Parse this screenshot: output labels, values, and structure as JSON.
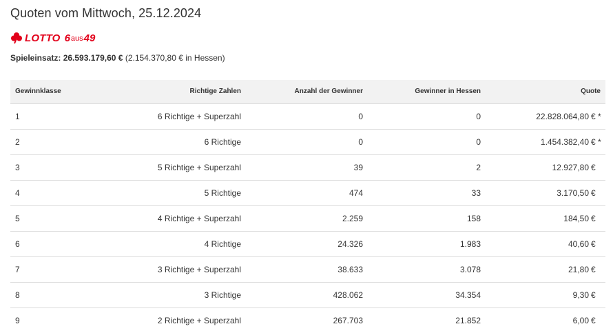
{
  "page": {
    "title": "Quoten vom Mittwoch, 25.12.2024"
  },
  "logo": {
    "word": "LOTTO",
    "six": "6",
    "aus": "aus",
    "fortynine": "49",
    "color": "#e2001a"
  },
  "stake": {
    "label": "Spieleinsatz:",
    "amount": "26.593.179,60",
    "currency": "€",
    "hessen": "(2.154.370,80  € in Hessen)"
  },
  "table": {
    "headers": [
      "Gewinnklasse",
      "Richtige Zahlen",
      "Anzahl der Gewinner",
      "Gewinner in Hessen",
      "Quote"
    ],
    "rows": [
      {
        "klasse": "1",
        "richtige": "6 Richtige + Superzahl",
        "anzahl": "0",
        "hessen": "0",
        "quote": "22.828.064,80",
        "suffix": "€ *"
      },
      {
        "klasse": "2",
        "richtige": "6 Richtige",
        "anzahl": "0",
        "hessen": "0",
        "quote": "1.454.382,40",
        "suffix": "€ *"
      },
      {
        "klasse": "3",
        "richtige": "5 Richtige + Superzahl",
        "anzahl": "39",
        "hessen": "2",
        "quote": "12.927,80",
        "suffix": "€"
      },
      {
        "klasse": "4",
        "richtige": "5 Richtige",
        "anzahl": "474",
        "hessen": "33",
        "quote": "3.170,50",
        "suffix": "€"
      },
      {
        "klasse": "5",
        "richtige": "4 Richtige + Superzahl",
        "anzahl": "2.259",
        "hessen": "158",
        "quote": "184,50",
        "suffix": "€"
      },
      {
        "klasse": "6",
        "richtige": "4 Richtige",
        "anzahl": "24.326",
        "hessen": "1.983",
        "quote": "40,60",
        "suffix": "€"
      },
      {
        "klasse": "7",
        "richtige": "3 Richtige + Superzahl",
        "anzahl": "38.633",
        "hessen": "3.078",
        "quote": "21,80",
        "suffix": "€"
      },
      {
        "klasse": "8",
        "richtige": "3 Richtige",
        "anzahl": "428.062",
        "hessen": "34.354",
        "quote": "9,30",
        "suffix": "€"
      },
      {
        "klasse": "9",
        "richtige": "2 Richtige + Superzahl",
        "anzahl": "267.703",
        "hessen": "21.852",
        "quote": "6,00",
        "suffix": "€"
      }
    ]
  },
  "icons": {
    "logo_mark": "clover-icon"
  }
}
